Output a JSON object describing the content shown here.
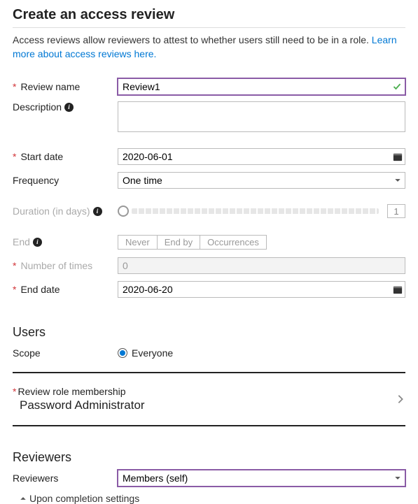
{
  "header": {
    "title": "Create an access review",
    "subtext": "Access reviews allow reviewers to attest to whether users still need to be in a role.",
    "link": "Learn more about access reviews here."
  },
  "fields": {
    "review_name": {
      "label": "Review name",
      "value": "Review1"
    },
    "description": {
      "label": "Description",
      "value": ""
    },
    "start_date": {
      "label": "Start date",
      "value": "2020-06-01"
    },
    "frequency": {
      "label": "Frequency",
      "value": "One time"
    },
    "duration": {
      "label": "Duration (in days)",
      "value": "1"
    },
    "end": {
      "label": "End",
      "options": [
        "Never",
        "End by",
        "Occurrences"
      ]
    },
    "num_times": {
      "label": "Number of times",
      "value": "0"
    },
    "end_date": {
      "label": "End date",
      "value": "2020-06-20"
    }
  },
  "users": {
    "title": "Users",
    "scope_label": "Scope",
    "scope_value": "Everyone"
  },
  "role": {
    "label": "Review role membership",
    "value": "Password Administrator"
  },
  "reviewers": {
    "title": "Reviewers",
    "label": "Reviewers",
    "value": "Members (self)",
    "expander": "Upon completion settings"
  }
}
